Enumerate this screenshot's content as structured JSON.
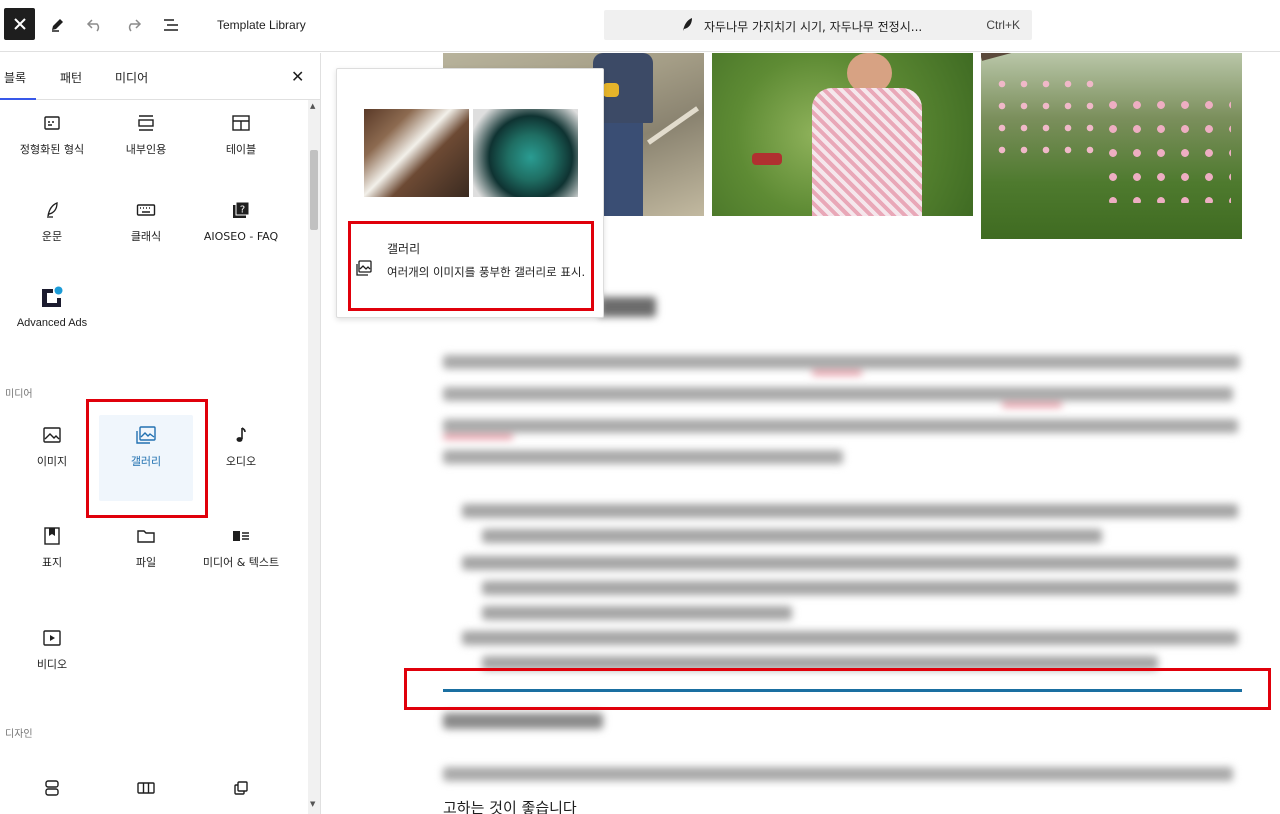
{
  "toolbar": {
    "template_library": "Template Library",
    "command_title": "자두나무 가지치기 시기, 자두나무 전정시...",
    "command_shortcut": "Ctrl+K"
  },
  "sidebar": {
    "tabs": [
      "블록",
      "패턴",
      "미디어"
    ],
    "sections": {
      "media": "미디어",
      "design": "디자인"
    },
    "text_blocks": [
      {
        "label": "정형화된 형식",
        "icon": "preformatted-icon"
      },
      {
        "label": "내부인용",
        "icon": "pullquote-icon"
      },
      {
        "label": "테이블",
        "icon": "table-icon"
      },
      {
        "label": "운문",
        "icon": "verse-icon"
      },
      {
        "label": "클래식",
        "icon": "keyboard-icon"
      },
      {
        "label": "AIOSEO - FAQ",
        "icon": "faq-icon"
      },
      {
        "label": "Advanced Ads",
        "icon": "advanced-ads-icon"
      }
    ],
    "media_blocks": [
      {
        "label": "이미지",
        "icon": "image-icon"
      },
      {
        "label": "갤러리",
        "icon": "gallery-icon"
      },
      {
        "label": "오디오",
        "icon": "audio-icon"
      },
      {
        "label": "표지",
        "icon": "cover-icon"
      },
      {
        "label": "파일",
        "icon": "file-icon"
      },
      {
        "label": "미디어 & 텍스트",
        "icon": "media-text-icon"
      },
      {
        "label": "비디오",
        "icon": "video-icon"
      }
    ]
  },
  "preview": {
    "title": "갤러리",
    "description": "여러개의 이미지를 풍부한 갤러리로 표시."
  },
  "content": {
    "last_line": "고하는 것이 좋습니다"
  },
  "colors": {
    "accent": "#3858e9",
    "selected_text": "#2271b1",
    "highlight_box": "#e0000b",
    "separator": "#1a6fa1"
  }
}
